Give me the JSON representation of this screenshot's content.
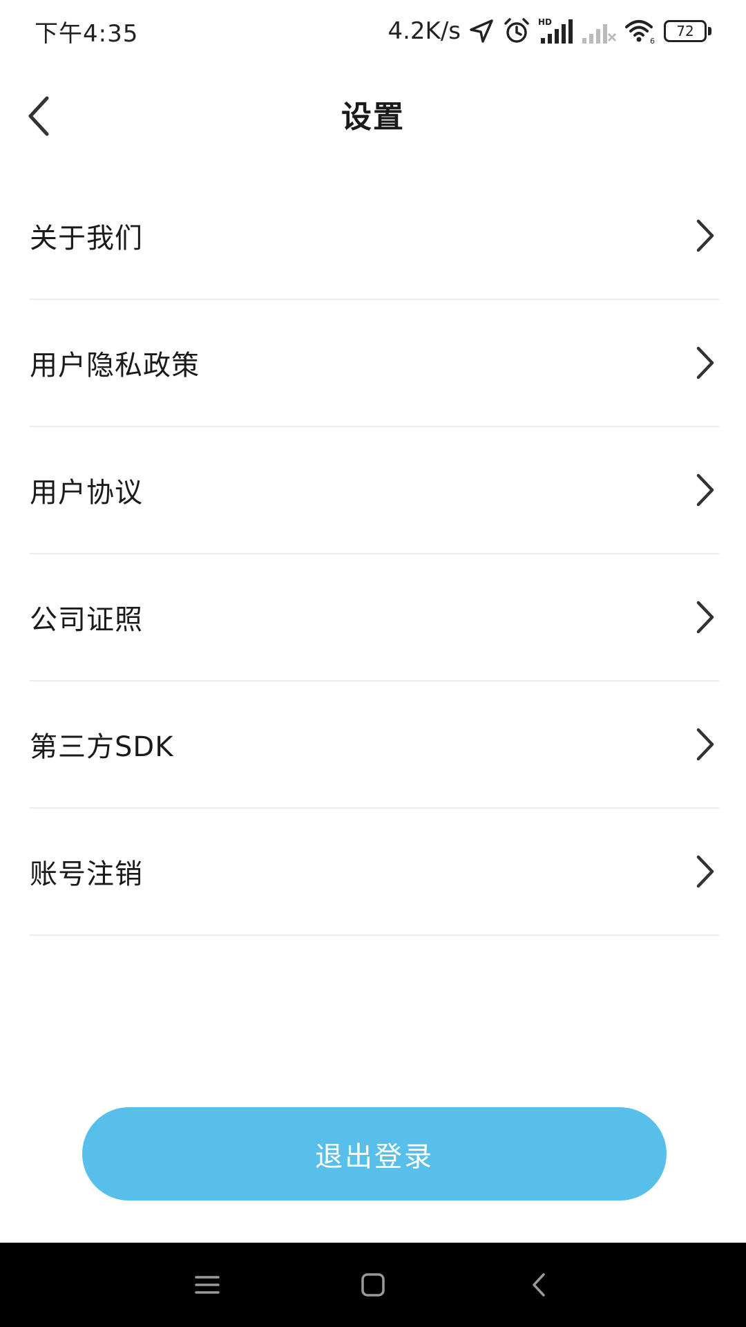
{
  "status_bar": {
    "time": "下午4:35",
    "net_speed": "4.2K/s",
    "battery_level": "72",
    "icons": [
      "location-arrow-icon",
      "alarm-icon",
      "hd-signal-icon",
      "signal-off-icon",
      "wifi-icon",
      "battery-icon"
    ]
  },
  "header": {
    "title": "设置",
    "back_icon": "chevron-left-icon"
  },
  "menu": {
    "items": [
      {
        "label": "关于我们"
      },
      {
        "label": "用户隐私政策"
      },
      {
        "label": "用户协议"
      },
      {
        "label": "公司证照"
      },
      {
        "label": "第三方SDK"
      },
      {
        "label": "账号注销"
      }
    ],
    "chevron_icon": "chevron-right-icon"
  },
  "logout": {
    "label": "退出登录",
    "color": "#58bfeb"
  },
  "nav_bar": {
    "icons": [
      "menu-icon",
      "home-icon",
      "back-icon"
    ]
  }
}
